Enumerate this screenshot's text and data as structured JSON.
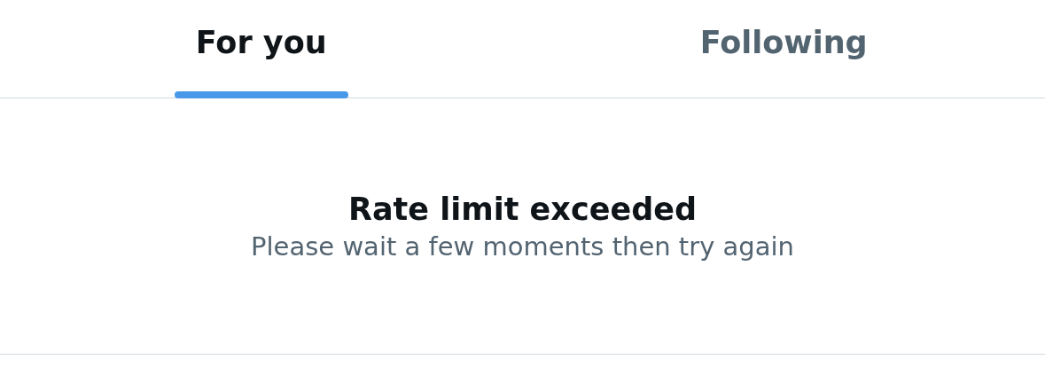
{
  "tabs": [
    {
      "label": "For you",
      "selected": true
    },
    {
      "label": "Following",
      "selected": false
    }
  ],
  "message": {
    "title": "Rate limit exceeded",
    "subtitle": "Please wait a few moments then try again"
  }
}
